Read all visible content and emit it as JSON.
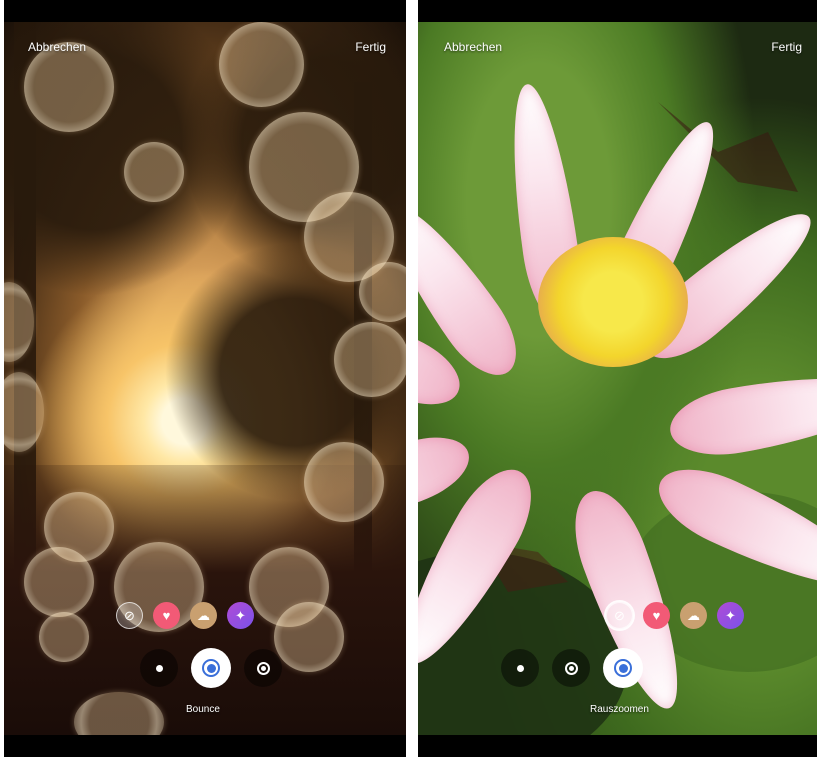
{
  "screens": [
    {
      "cancel_label": "Abbrechen",
      "done_label": "Fertig",
      "mode_label": "Bounce",
      "selected_mode": "bounce",
      "effects": [
        "none-icon",
        "heart-icon",
        "dreamy-icon",
        "sparkle-icon"
      ]
    },
    {
      "cancel_label": "Abbrechen",
      "done_label": "Fertig",
      "mode_label": "Rauszoomen",
      "selected_mode": "zoom-out",
      "effects": [
        "none-icon",
        "heart-icon",
        "dreamy-icon",
        "sparkle-icon"
      ]
    }
  ],
  "colors": {
    "heart_chip": "#f25a76",
    "sparkle_chip": "#8a4fe0",
    "active_mode_ring": "#3a6fd9"
  }
}
